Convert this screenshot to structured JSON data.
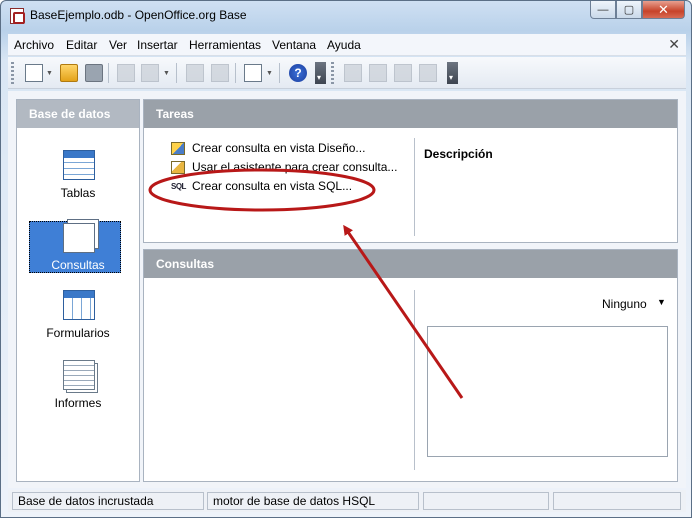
{
  "window": {
    "title": "BaseEjemplo.odb - OpenOffice.org Base",
    "minimize_label": "—",
    "restore_label": "▢",
    "close_label": "✕"
  },
  "menubar": {
    "items": [
      "Archivo",
      "Editar",
      "Ver",
      "Insertar",
      "Herramientas",
      "Ventana",
      "Ayuda"
    ],
    "close_label": "✕"
  },
  "toolbar": {
    "icons": [
      "new-document-icon",
      "open-folder-icon",
      "save-disk-icon",
      "copy-icon",
      "paste-icon",
      "sort-ascending-icon",
      "sort-descending-icon",
      "form-icon",
      "help-icon",
      "open-object-icon",
      "edit-object-icon",
      "delete-object-icon",
      "rename-object-icon"
    ]
  },
  "left_pane": {
    "header": "Base de datos",
    "items": [
      {
        "label": "Tablas",
        "icon": "tables-icon",
        "selected": false
      },
      {
        "label": "Consultas",
        "icon": "queries-icon",
        "selected": true
      },
      {
        "label": "Formularios",
        "icon": "forms-icon",
        "selected": false
      },
      {
        "label": "Informes",
        "icon": "reports-icon",
        "selected": false
      }
    ]
  },
  "tasks_panel": {
    "header": "Tareas",
    "tasks": [
      {
        "label": "Crear consulta en vista Diseño...",
        "icon": "design-view-icon"
      },
      {
        "label": "Usar el asistente para crear consulta...",
        "icon": "wizard-icon"
      },
      {
        "label": "Crear consulta en vista SQL...",
        "icon": "sql-icon",
        "icon_text": "SQL"
      }
    ],
    "description_title": "Descripción"
  },
  "consultas_panel": {
    "header": "Consultas",
    "preview_select": "Ninguno"
  },
  "statusbar": {
    "cells": [
      "Base de datos incrustada",
      "motor de base de datos HSQL",
      "",
      ""
    ]
  },
  "colors": {
    "selection": "#3f7fd6",
    "annotation": "#b81818",
    "pane_header": "#b2b9c2"
  }
}
